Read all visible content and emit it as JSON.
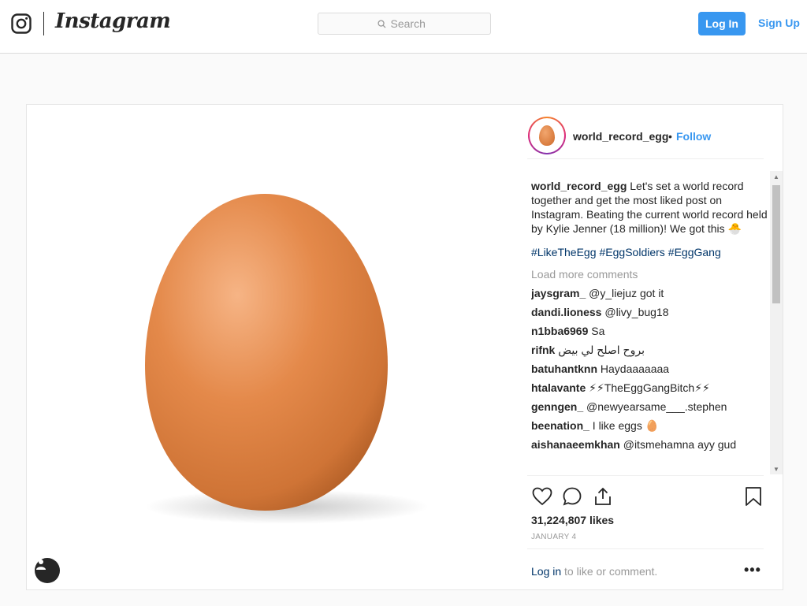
{
  "nav": {
    "brand": "Instagram",
    "search_placeholder": "Search",
    "login_label": "Log In",
    "signup_label": "Sign Up"
  },
  "post": {
    "username": "world_record_egg",
    "separator": "•",
    "follow_label": "Follow",
    "caption_user": "world_record_egg",
    "caption_text": "Let's set a world record together and get the most liked post on Instagram. Beating the current world record held by Kylie Jenner (18 million)! We got this 🐣",
    "hashtags": [
      "#LikeTheEgg",
      "#EggSoldiers",
      "#EggGang"
    ],
    "load_more": "Load more comments",
    "comments": [
      {
        "user": "jaysgram_",
        "text": "@y_liejuz got it"
      },
      {
        "user": "dandi.lioness",
        "text": "@livy_bug18"
      },
      {
        "user": "n1bba6969",
        "text": "Sa"
      },
      {
        "user": "rifnk",
        "text": "بروح اصلح لي بيض"
      },
      {
        "user": "batuhantknn",
        "text": "Haydaaaaaaa"
      },
      {
        "user": "htalavante",
        "text": "⚡⚡TheEggGangBitch⚡⚡"
      },
      {
        "user": "genngen_",
        "text": "@newyearsame___.stephen"
      },
      {
        "user": "beenation_",
        "text": "I like eggs 🥚"
      },
      {
        "user": "aishanaeemkhan",
        "text": "@itsmehamna ayy gud"
      }
    ],
    "likes": "31,224,807 likes",
    "date": "JANUARY 4",
    "login_link": "Log in",
    "login_suffix": " to like or comment.",
    "more_label": "•••"
  },
  "icons": {
    "instagram": "instagram-glyph-icon",
    "search": "search-icon",
    "heart": "heart-icon",
    "comment": "comment-icon",
    "share": "share-icon",
    "bookmark": "bookmark-icon",
    "user_tag": "user-tag-icon"
  },
  "colors": {
    "accent": "#3897f0",
    "link": "#003569",
    "muted": "#999999",
    "egg": "#e08a4c"
  }
}
